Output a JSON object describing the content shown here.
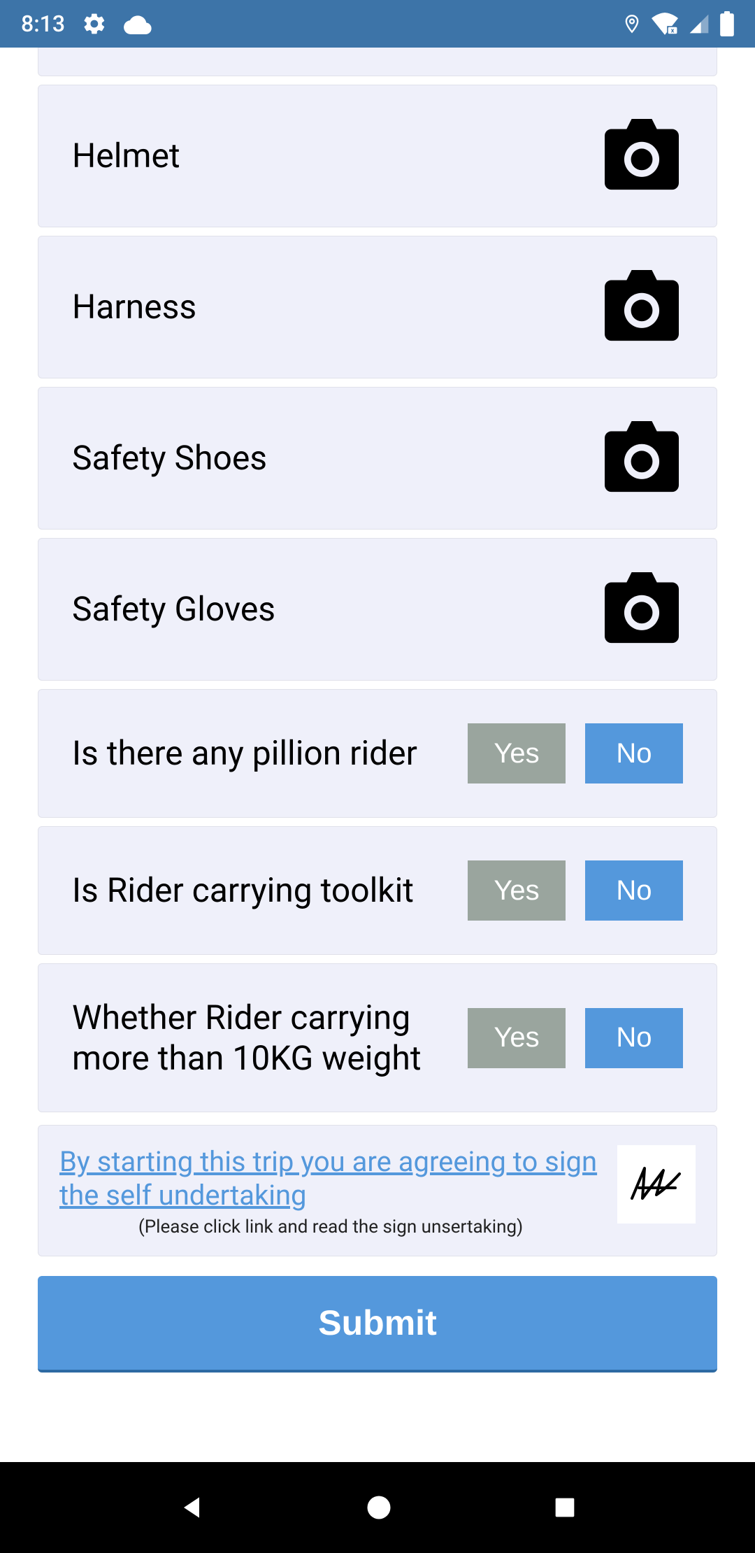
{
  "statusbar": {
    "time": "8:13"
  },
  "photoItems": [
    {
      "label": "Helmet"
    },
    {
      "label": "Harness"
    },
    {
      "label": "Safety Shoes"
    },
    {
      "label": "Safety Gloves"
    }
  ],
  "questions": [
    {
      "label": "Is there any pillion rider",
      "yes": "Yes",
      "no": "No"
    },
    {
      "label": "Is Rider carrying toolkit",
      "yes": "Yes",
      "no": "No"
    },
    {
      "label": "Whether Rider carrying more than 10KG weight",
      "yes": "Yes",
      "no": "No"
    }
  ],
  "undertaking": {
    "link": "By starting this trip you are agreeing to sign the self undertaking",
    "note": "(Please click link and read the sign unsertaking)"
  },
  "submit": {
    "label": "Submit"
  }
}
